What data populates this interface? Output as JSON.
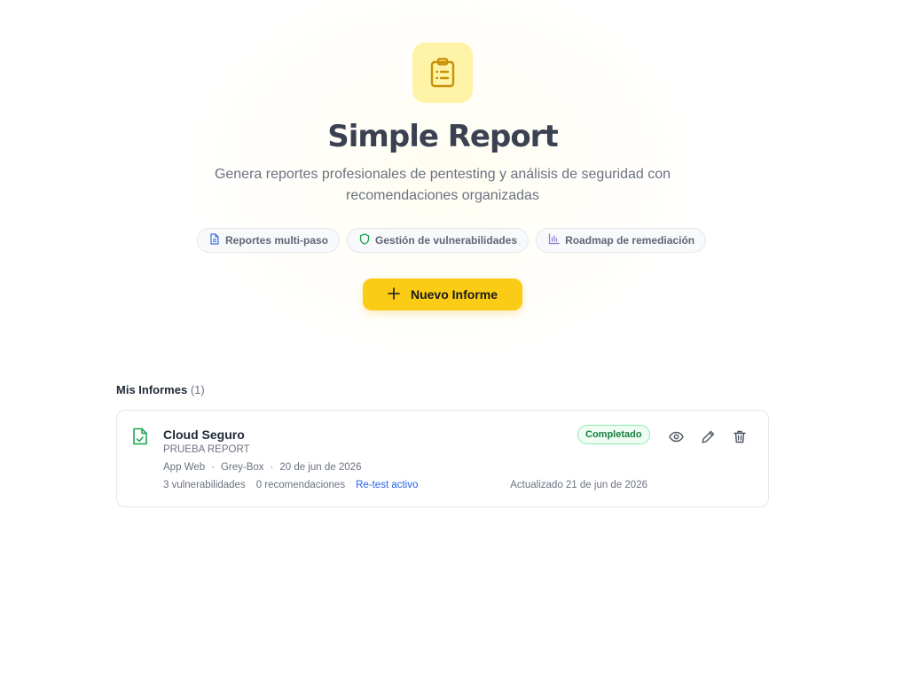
{
  "hero": {
    "icon": "clipboard-list-icon",
    "title": "Simple Report",
    "subtitle": "Genera reportes profesionales de pentesting y análisis de seguridad con recomendaciones organizadas"
  },
  "features": [
    {
      "icon": "file-text-icon",
      "label": "Reportes multi-paso"
    },
    {
      "icon": "shield-icon",
      "label": "Gestión de vulnerabilidades"
    },
    {
      "icon": "bar-chart-icon",
      "label": "Roadmap de remediación"
    }
  ],
  "new_report_button": {
    "icon": "plus-icon",
    "label": "Nuevo Informe"
  },
  "reports_section": {
    "title": "Mis Informes",
    "count": "(1)"
  },
  "reports": [
    {
      "icon": "file-check-icon",
      "title": "Cloud Seguro",
      "client": "PRUEBA REPORT",
      "type": "App Web",
      "methodology": "Grey-Box",
      "date": "20 de jun de 2026",
      "separator": "·",
      "vulnerabilities": "3 vulnerabilidades",
      "recommendations": "0 recomendaciones",
      "retest": "Re-test activo",
      "updated": "Actualizado 21 de jun de 2026",
      "status": "Completado",
      "actions": [
        "eye-icon",
        "pencil-icon",
        "trash-icon"
      ]
    }
  ],
  "colors": {
    "accent": "#facc15",
    "status_green": "#15803d",
    "link_blue": "#2563eb"
  }
}
